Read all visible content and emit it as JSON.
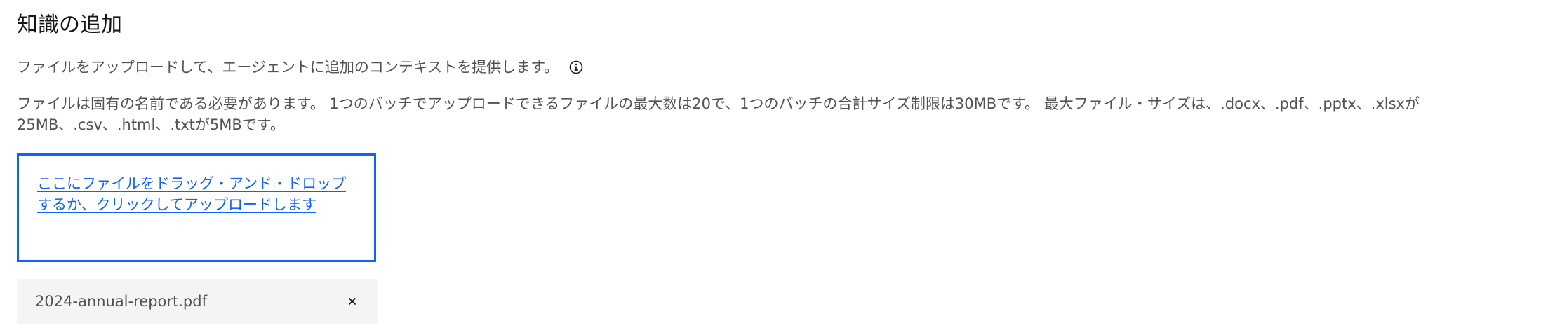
{
  "section": {
    "title": "知識の追加",
    "subtitle": "ファイルをアップロードして、エージェントに追加のコンテキストを提供します。",
    "info_icon": "information-icon",
    "limits_text": "ファイルは固有の名前である必要があります。 1つのバッチでアップロードできるファイルの最大数は20で、1つのバッチの合計サイズ制限は30MBです。 最大ファイル・サイズは、.docx、.pdf、.pptx、.xlsxが25MB、.csv、.html、.txtが5MBです。"
  },
  "dropzone": {
    "label": "ここにファイルをドラッグ・アンド・ドロップするか、クリックしてアップロードします"
  },
  "files": [
    {
      "name": "2024-annual-report.pdf",
      "remove_icon": "close-icon"
    }
  ],
  "colors": {
    "accent": "#0f62fe",
    "text_primary": "#161616",
    "text_secondary": "#525252",
    "file_item_bg": "#f4f4f4"
  }
}
